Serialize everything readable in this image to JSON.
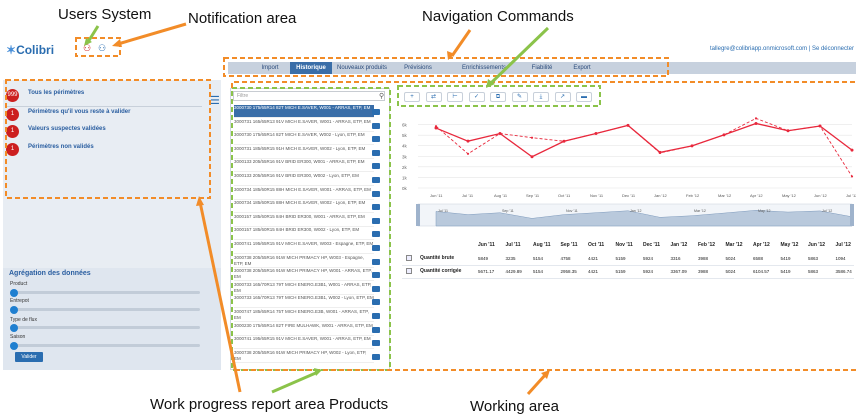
{
  "annotations": {
    "users_system": "Users System",
    "notification_area": "Notification area",
    "navigation_commands": "Navigation  Commands",
    "work_progress_products": "Work progress report area  Products",
    "working_area": "Working area"
  },
  "app": {
    "logo_text": "Colibri",
    "user_email": "tallegre@colibriapp.onmicrosoft.com | Se déconnecter"
  },
  "nav": {
    "tabs": [
      "Import",
      "Historique",
      "Nouveaux produits",
      "Prévisions",
      "Enrichissements",
      "Fiabilité",
      "Export"
    ],
    "active": "Historique"
  },
  "sidebar": {
    "items": [
      {
        "badge": "999",
        "label": "Tous les périmètres"
      },
      {
        "badge": "1",
        "label": "Périmètres qu'il vous reste à valider"
      },
      {
        "badge": "1",
        "label": "Valeurs suspectes validées"
      },
      {
        "badge": "1",
        "label": "Périmètres non validés"
      }
    ]
  },
  "aggregation": {
    "title": "Agrégation des données",
    "sliders": [
      "Product",
      "Entrepot",
      "Type de flux",
      "Saison"
    ],
    "button": "Valider"
  },
  "products": {
    "filter_placeholder": "Filtre",
    "items": [
      "3000730 175/65R14 82T MICH E.SAVER, W001 - ARRAS, ETP, EM",
      "3000731 165/65R13 91V MICH E.SAVER, W001 - ARRAS, ETP, EM",
      "3000730 175/65R14 82T MICH E.SAVER, W002 - Lyon, ETP, EM",
      "3000731 185/65R15 91H MICH E.SAVER, W002 - Lyon, ETP, EM",
      "3000133 205/55R16 91V BRID ER300, W001 - ARRAS, ETP, EM",
      "3000133 205/55R16 91V BRID ER300, W002 - Lyon, ETP, EM",
      "3000734 185/60R15 88H MICH E.SAVER, W001 - ARRAS, ETP, EM",
      "3000734 185/60R15 88H MICH E.SAVER, W002 - Lyon, ETP, EM",
      "3000157 185/60R15 84H BRID ER300, W001 - ARRAS, ETP, EM",
      "3000157 185/60R15 84H BRID ER300, W002 - Lyon, ETP, EM",
      "3000741 195/65R15 91V MICH E.SAVER, W003 - Espagne, ETP, EM",
      "3000738 205/55R16 91W MICH PRIMACY HP, W003 - Espagne, ETP, EM",
      "3000738 205/55R16 91W MICH PRIMACY HP, W001 - ARRAS, ETP, EM",
      "3000733 165/70R13 79T MICH ENERG.E3B1, W001 - ARRAS, ETP, EM",
      "3000733 165/70R13 79T MICH ENERG.E3B1, W002 - Lyon, ETP, EM",
      "3000747 185/65R14 75T MICH ENERG.E3B, W001 - ARRAS, ETP, EM",
      "3000230 175/65R14 82T FIRE MULHAWK, W001 - ARRAS, ETP, EM",
      "3000741 195/65R15 91V MICH E.SAVER, W001 - ARRAS, ETP, EM",
      "3000738 205/55R16 91W MICH PRIMACY HP, W002 - Lyon, ETP, EM"
    ]
  },
  "toolbar": {
    "icons": [
      "add-points-icon",
      "compare-icon",
      "split-icon",
      "check-icon",
      "copy-icon",
      "edit-icon",
      "insert-icon",
      "trend-icon",
      "comment-icon"
    ]
  },
  "chart_data": {
    "type": "line",
    "x": [
      "Jun '11",
      "Jul '11",
      "Aug '11",
      "Sep '11",
      "Oct '11",
      "Nov '11",
      "Dec '11",
      "Jan '12",
      "Feb '12",
      "Mar '12",
      "Apr '12",
      "May '12",
      "Jun '12",
      "Jul '12"
    ],
    "series": [
      {
        "name": "Quantité brute",
        "values": [
          5849,
          3235,
          5154,
          4758,
          4421,
          5159,
          5924,
          3316,
          3988,
          5024,
          6588,
          5419,
          5863,
          1094
        ]
      },
      {
        "name": "Quantité corrigée",
        "values": [
          5671.17,
          4429.89,
          5154,
          2958.35,
          4421,
          5159,
          5924,
          3367.09,
          3988,
          5024,
          6104.57,
          5419,
          5863,
          3586.74
        ]
      }
    ],
    "y_ticks": [
      "6k",
      "5k",
      "4k",
      "3k",
      "2k",
      "1k",
      "0k"
    ],
    "ylim": [
      0,
      7000
    ],
    "navigator_labels": [
      "Jul '11",
      "Sep '11",
      "Nov '11",
      "Jan '12",
      "Mar '12",
      "May '12",
      "Jul '12"
    ]
  },
  "table": {
    "headers": [
      "Jun '11",
      "Jul '11",
      "Aug '11",
      "Sep '11",
      "Oct '11",
      "Nov '11",
      "Dec '11",
      "Jan '12",
      "Feb '12",
      "Mar '12",
      "Apr '12",
      "May '12",
      "Jun '12",
      "Jul '12"
    ],
    "rows": [
      {
        "label": "Quantité brute",
        "values": [
          "5849",
          "3235",
          "5154",
          "4758",
          "4421",
          "5159",
          "5924",
          "3316",
          "3988",
          "5024",
          "6588",
          "5419",
          "5863",
          "1094"
        ]
      },
      {
        "label": "Quantité corrigée",
        "values": [
          "5671.17",
          "4429.89",
          "5154",
          "2958.35",
          "4421",
          "5159",
          "5924",
          "3367.09",
          "3988",
          "5024",
          "6104.57",
          "5419",
          "5863",
          "3586.74"
        ]
      }
    ]
  },
  "colors": {
    "accent": "#3a6ea8",
    "annotation_orange": "#f28c28",
    "annotation_green": "#8bc34a",
    "line_red": "#e8283c",
    "badge_red": "#cc1f1f"
  }
}
